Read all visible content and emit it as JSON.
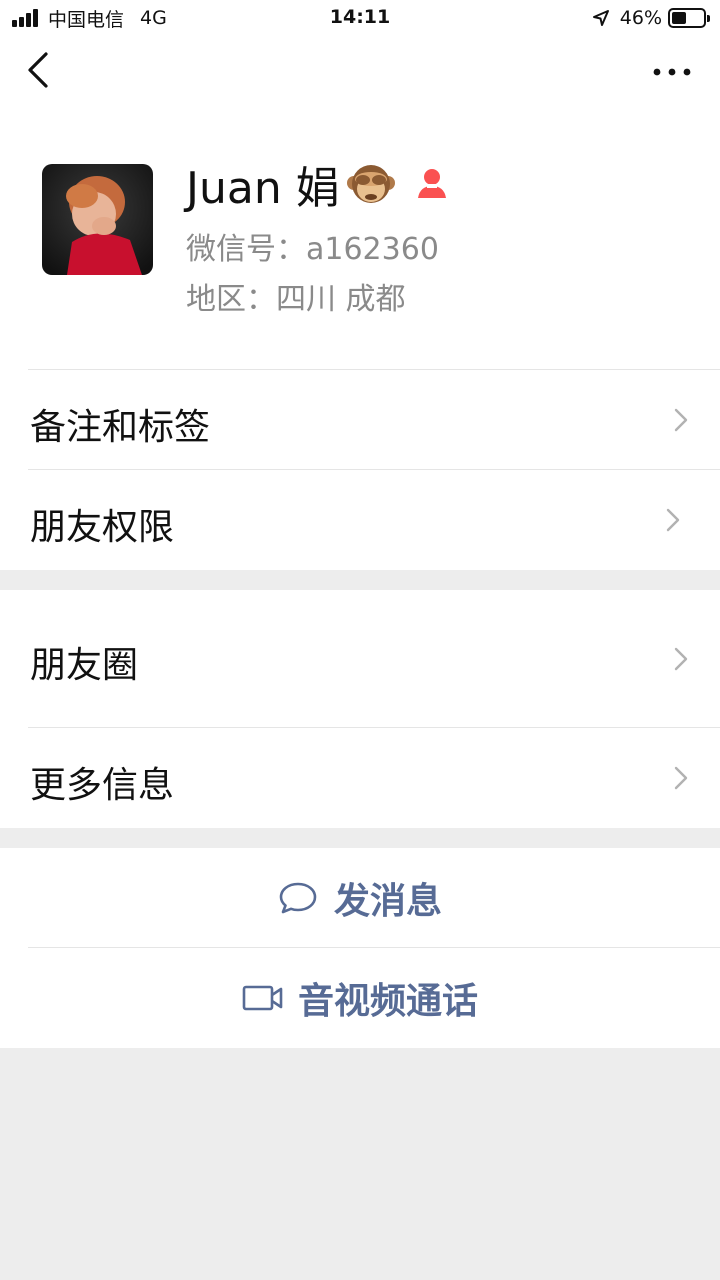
{
  "status_bar": {
    "carrier": "中国电信",
    "network": "4G",
    "time": "14:11",
    "battery_level": "46%",
    "battery_fraction": 0.46
  },
  "nav": {
    "back_icon": "chevron-left-icon",
    "more_icon": "ellipsis-icon"
  },
  "profile": {
    "name": "Juan 娟",
    "wechat_id": "微信号：a162360",
    "region": "地区：四川 成都",
    "gender_color": "#fa5151"
  },
  "menu_group_1": {
    "items": [
      {
        "label": "备注和标签"
      },
      {
        "label": "朋友权限"
      }
    ]
  },
  "menu_group_2": {
    "items": [
      {
        "label": "朋友圈"
      },
      {
        "label": "更多信息"
      }
    ]
  },
  "actions": {
    "message_label": "发消息",
    "call_label": "音视频通话",
    "accent_color": "#576b95"
  }
}
